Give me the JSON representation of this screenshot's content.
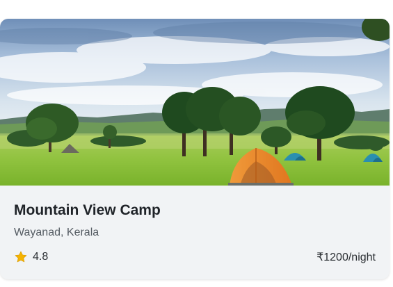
{
  "card": {
    "image_alt": "Tents pitched on a green meadow with trees and distant hills",
    "title": "Mountain View Camp",
    "location": "Wayanad, Kerala",
    "rating": "4.8",
    "rating_icon": "star-icon",
    "price": "₹1200/night",
    "colors": {
      "card_bg": "#f1f3f5",
      "title": "#1f2328",
      "subtle_text": "#555c63",
      "star": "#f5b301"
    }
  }
}
